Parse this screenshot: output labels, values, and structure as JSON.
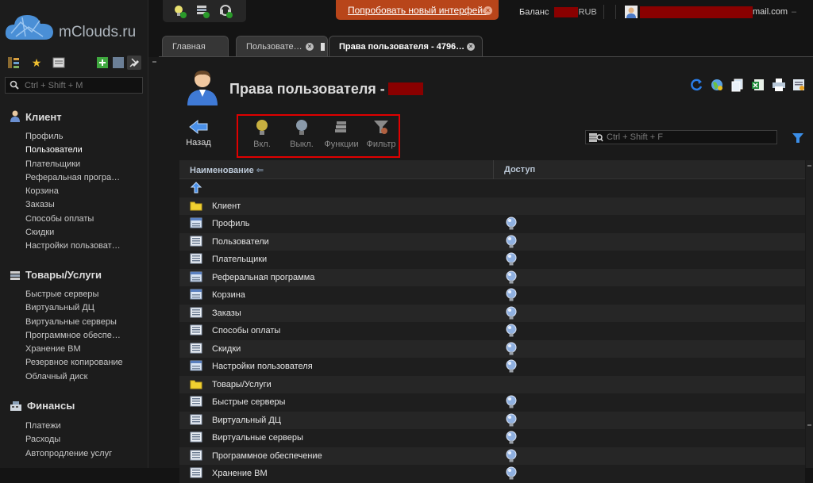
{
  "logo": {
    "text": "mClouds.ru"
  },
  "sidebar": {
    "search_placeholder": "Ctrl + Shift + M",
    "tool_icons": [
      "tree-icon",
      "star-icon",
      "notes-icon",
      "add-icon",
      "window-icon",
      "pin-icon"
    ],
    "sections": [
      {
        "title": "Клиент",
        "icon": "client-icon",
        "items": [
          "Профиль",
          "Пользователи",
          "Плательщики",
          "Реферальная програ…",
          "Корзина",
          "Заказы",
          "Способы оплаты",
          "Скидки",
          "Настройки пользоват…"
        ]
      },
      {
        "title": "Товары/Услуги",
        "icon": "services-icon",
        "items": [
          "Быстрые серверы",
          "Виртуальный ДЦ",
          "Виртуальные серверы",
          "Программное обеспе…",
          "Хранение ВМ",
          "Резервное копирование",
          "Облачный диск"
        ]
      },
      {
        "title": "Финансы",
        "icon": "finance-icon",
        "items": [
          "Платежи",
          "Расходы",
          "Автопродление услуг"
        ]
      }
    ],
    "active_item": "Пользователи"
  },
  "topbar": {
    "promo_text": "Попробовать новый интерфейс",
    "balance_label": "Баланс",
    "balance_currency": "RUB",
    "user_email_suffix": "mail.com",
    "colors": {
      "promo": "#b8451a",
      "redaction": "#8a0000"
    }
  },
  "tabs": [
    {
      "label": "Главная",
      "active": false,
      "closable": false
    },
    {
      "label": "Пользовате…",
      "active": false,
      "closable": true
    },
    {
      "label": "Права пользователя - 4796…",
      "active": true,
      "closable": true
    }
  ],
  "page": {
    "title": "Права пользователя -",
    "back_label": "Назад",
    "actions": [
      {
        "label": "Вкл.",
        "icon": "bulb-on-icon"
      },
      {
        "label": "Выкл.",
        "icon": "bulb-off-icon"
      },
      {
        "label": "Функции",
        "icon": "functions-icon"
      },
      {
        "label": "Фильтр",
        "icon": "filter-icon"
      }
    ],
    "filter_placeholder": "Ctrl + Shift + F",
    "right_tools": [
      "refresh-icon",
      "globe-icon",
      "copy-icon",
      "excel-icon",
      "print-icon",
      "settings-icon"
    ]
  },
  "table": {
    "columns": [
      "Наименование",
      "Доступ"
    ],
    "rows": [
      {
        "name": "",
        "type": "up",
        "access": false
      },
      {
        "name": "Клиент",
        "type": "folder",
        "access": false
      },
      {
        "name": "Профиль",
        "type": "form",
        "access": true
      },
      {
        "name": "Пользователи",
        "type": "list",
        "access": true
      },
      {
        "name": "Плательщики",
        "type": "list",
        "access": true
      },
      {
        "name": "Реферальная программа",
        "type": "form",
        "access": true
      },
      {
        "name": "Корзина",
        "type": "form",
        "access": true
      },
      {
        "name": "Заказы",
        "type": "list",
        "access": true
      },
      {
        "name": "Способы оплаты",
        "type": "list",
        "access": true
      },
      {
        "name": "Скидки",
        "type": "list",
        "access": true
      },
      {
        "name": "Настройки пользователя",
        "type": "form",
        "access": true
      },
      {
        "name": "Товары/Услуги",
        "type": "folder",
        "access": false
      },
      {
        "name": "Быстрые серверы",
        "type": "list",
        "access": true
      },
      {
        "name": "Виртуальный ДЦ",
        "type": "list",
        "access": true
      },
      {
        "name": "Виртуальные серверы",
        "type": "list",
        "access": true
      },
      {
        "name": "Программное обеспечение",
        "type": "list",
        "access": true
      },
      {
        "name": "Хранение ВМ",
        "type": "list",
        "access": true
      }
    ]
  }
}
